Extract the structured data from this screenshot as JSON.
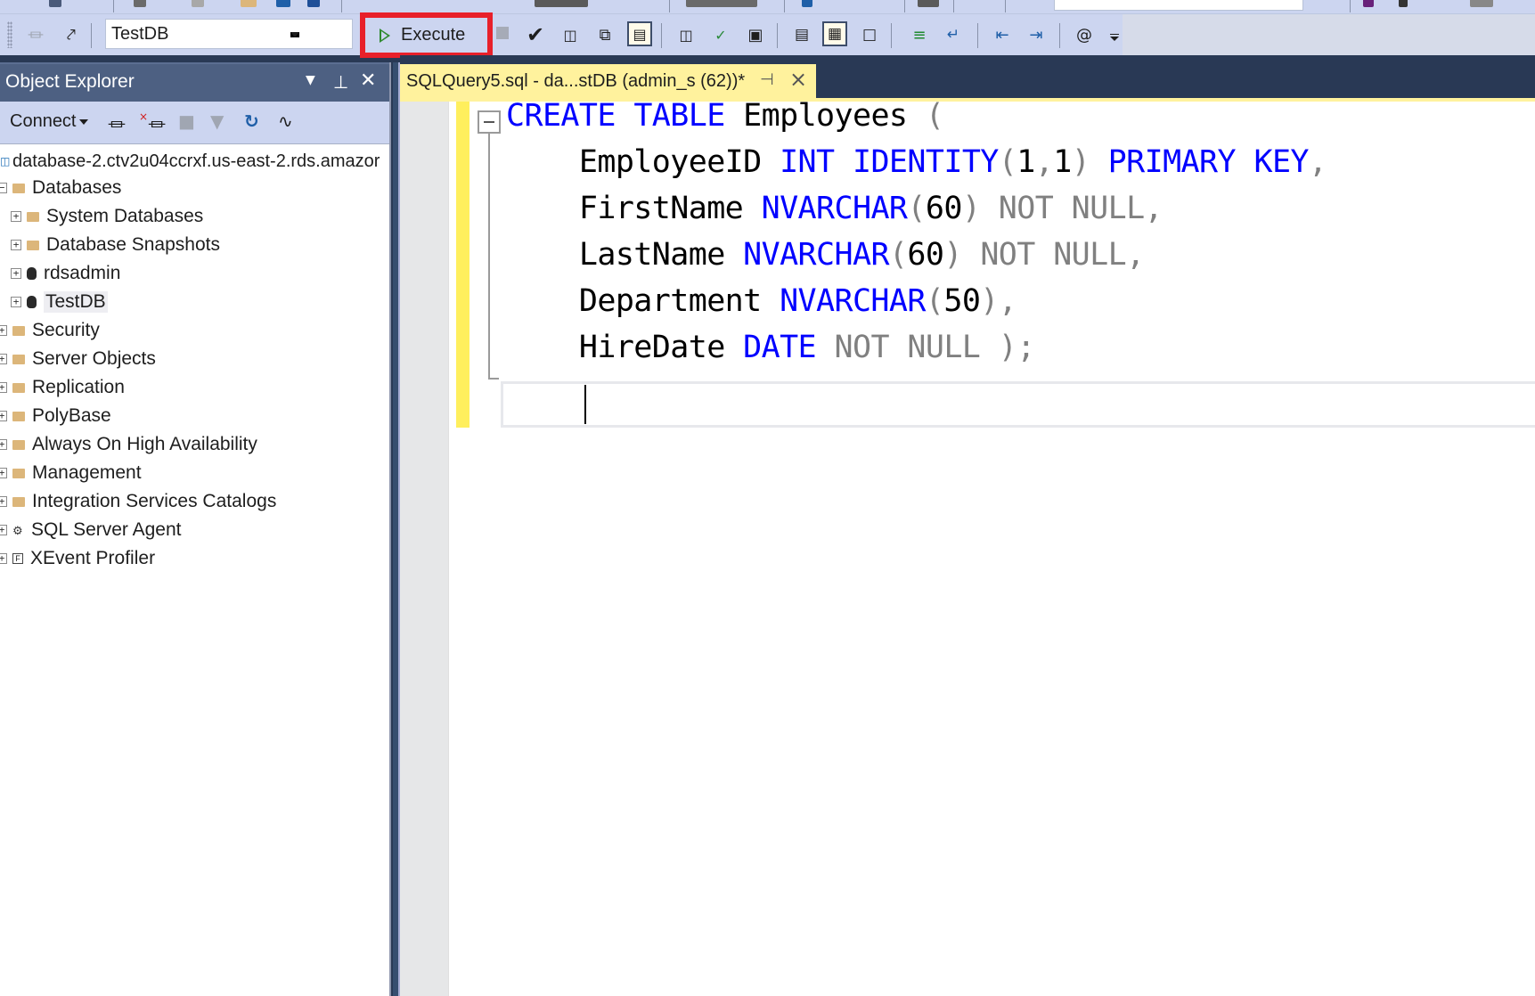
{
  "toolbar": {
    "database_selector": {
      "value": "TestDB"
    },
    "execute_label": "Execute",
    "icons": [
      "parse-check-icon",
      "display-estimated-plan-icon",
      "query-options-icon",
      "intellisense-enabled-icon",
      "include-actual-plan-icon",
      "include-live-stats-icon",
      "include-client-stats-icon",
      "results-to-text-icon",
      "results-to-grid-icon",
      "results-to-file-icon",
      "comment-lines-icon",
      "uncomment-lines-icon",
      "decrease-indent-icon",
      "increase-indent-icon",
      "specify-template-values-icon"
    ]
  },
  "object_explorer": {
    "title": "Object Explorer",
    "connect_label": "Connect",
    "server": "database-2.ctv2u04ccrxf.us-east-2.rds.amazor",
    "tree": [
      {
        "label": "Databases",
        "type": "folder",
        "expanded": true,
        "level": 1
      },
      {
        "label": "System Databases",
        "type": "folder",
        "expanded": false,
        "level": 2
      },
      {
        "label": "Database Snapshots",
        "type": "folder",
        "expanded": false,
        "level": 2
      },
      {
        "label": "rdsadmin",
        "type": "database",
        "expanded": false,
        "level": 2
      },
      {
        "label": "TestDB",
        "type": "database",
        "expanded": false,
        "level": 2,
        "selected": true
      },
      {
        "label": "Security",
        "type": "folder",
        "expanded": false,
        "level": 1
      },
      {
        "label": "Server Objects",
        "type": "folder",
        "expanded": false,
        "level": 1
      },
      {
        "label": "Replication",
        "type": "folder",
        "expanded": false,
        "level": 1
      },
      {
        "label": "PolyBase",
        "type": "folder",
        "expanded": false,
        "level": 1
      },
      {
        "label": "Always On High Availability",
        "type": "folder",
        "expanded": false,
        "level": 1
      },
      {
        "label": "Management",
        "type": "folder",
        "expanded": false,
        "level": 1
      },
      {
        "label": "Integration Services Catalogs",
        "type": "folder",
        "expanded": false,
        "level": 1
      },
      {
        "label": "SQL Server Agent",
        "type": "agent",
        "expanded": false,
        "level": 1
      },
      {
        "label": "XEvent Profiler",
        "type": "xevent",
        "expanded": false,
        "level": 1
      }
    ]
  },
  "editor": {
    "tab_title": "SQLQuery5.sql - da...stDB (admin_s (62))*",
    "code_lines": [
      [
        {
          "t": "CREATE",
          "c": "kw"
        },
        {
          "t": " ",
          "c": "id"
        },
        {
          "t": "TABLE",
          "c": "kw"
        },
        {
          "t": " Employees ",
          "c": "id"
        },
        {
          "t": "(",
          "c": "gr"
        }
      ],
      [
        {
          "t": "    EmployeeID ",
          "c": "id"
        },
        {
          "t": "INT",
          "c": "kw"
        },
        {
          "t": " ",
          "c": "id"
        },
        {
          "t": "IDENTITY",
          "c": "kw"
        },
        {
          "t": "(",
          "c": "gr"
        },
        {
          "t": "1",
          "c": "num"
        },
        {
          "t": ",",
          "c": "gr"
        },
        {
          "t": "1",
          "c": "num"
        },
        {
          "t": ")",
          "c": "gr"
        },
        {
          "t": " ",
          "c": "id"
        },
        {
          "t": "PRIMARY",
          "c": "kw"
        },
        {
          "t": " ",
          "c": "id"
        },
        {
          "t": "KEY",
          "c": "kw"
        },
        {
          "t": ",",
          "c": "gr"
        }
      ],
      [
        {
          "t": "    FirstName ",
          "c": "id"
        },
        {
          "t": "NVARCHAR",
          "c": "kw"
        },
        {
          "t": "(",
          "c": "gr"
        },
        {
          "t": "60",
          "c": "num"
        },
        {
          "t": ")",
          "c": "gr"
        },
        {
          "t": " NOT NULL,",
          "c": "gr"
        }
      ],
      [
        {
          "t": "    LastName ",
          "c": "id"
        },
        {
          "t": "NVARCHAR",
          "c": "kw"
        },
        {
          "t": "(",
          "c": "gr"
        },
        {
          "t": "60",
          "c": "num"
        },
        {
          "t": ")",
          "c": "gr"
        },
        {
          "t": " NOT NULL,",
          "c": "gr"
        }
      ],
      [
        {
          "t": "    Department ",
          "c": "id"
        },
        {
          "t": "NVARCHAR",
          "c": "kw"
        },
        {
          "t": "(",
          "c": "gr"
        },
        {
          "t": "50",
          "c": "num"
        },
        {
          "t": "),",
          "c": "gr"
        }
      ],
      [
        {
          "t": "    HireDate ",
          "c": "id"
        },
        {
          "t": "DATE",
          "c": "kw"
        },
        {
          "t": " NOT NULL );",
          "c": "gr"
        }
      ],
      []
    ]
  },
  "colors": {
    "keyword": "#0000ff",
    "identifier": "#000000",
    "operator": "#808080",
    "highlight_box": "#e8202a",
    "tab_active": "#fff29d",
    "panel_title": "#4d6082"
  }
}
